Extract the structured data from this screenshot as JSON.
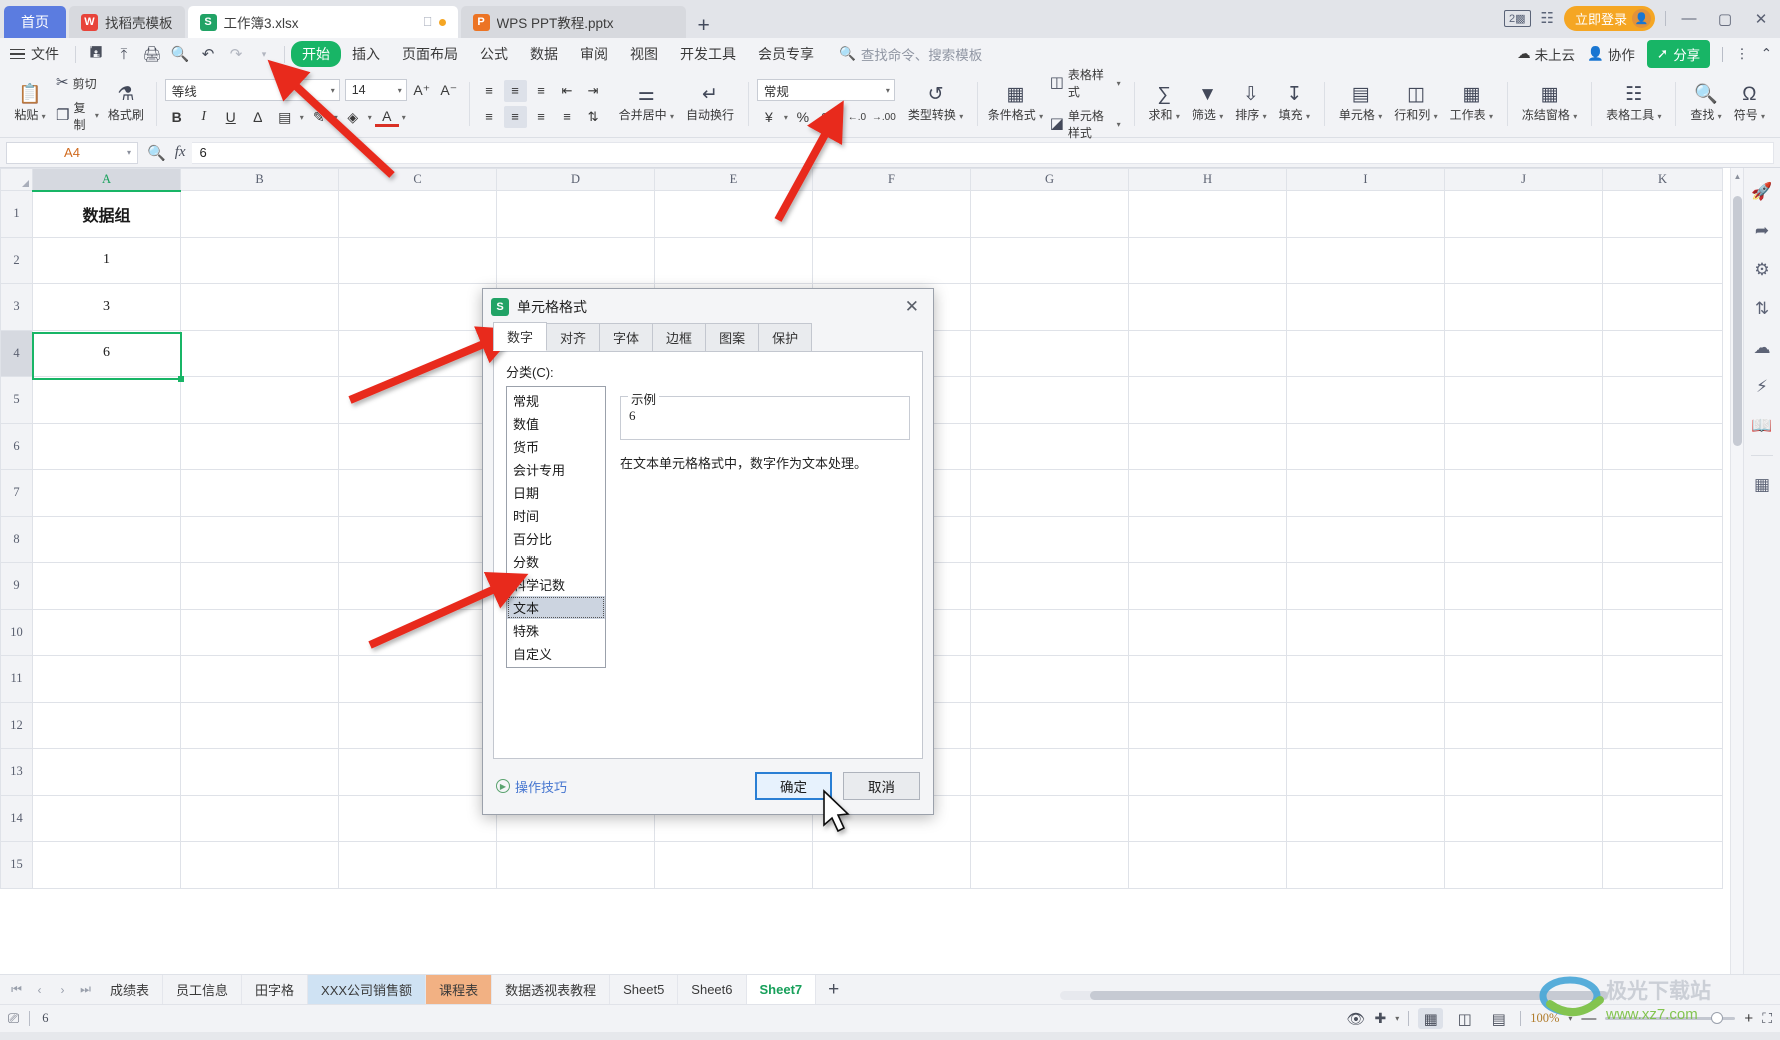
{
  "window": {
    "doc_count_badge": "2",
    "login_label": "立即登录",
    "minimize": "—",
    "maximize": "▢",
    "close": "✕"
  },
  "tabs": [
    {
      "label": "首页",
      "icon": "home-icon",
      "type": "home"
    },
    {
      "label": "找稻壳模板",
      "icon": "docer-icon",
      "type": "docer"
    },
    {
      "label": "工作簿3.xlsx",
      "icon": "xlsx-icon",
      "type": "xlsx",
      "active": true
    },
    {
      "label": "WPS PPT教程.pptx",
      "icon": "pptx-icon",
      "type": "pptx"
    }
  ],
  "tab_new_label": "+",
  "menu": {
    "file_label": "文件",
    "quick_icons": [
      "save-icon",
      "save-as-icon",
      "print-icon",
      "print-preview-icon",
      "undo-icon",
      "redo-icon",
      "customize-qat-icon"
    ],
    "items": [
      {
        "label": "开始",
        "active": true
      },
      {
        "label": "插入"
      },
      {
        "label": "页面布局"
      },
      {
        "label": "公式"
      },
      {
        "label": "数据"
      },
      {
        "label": "审阅"
      },
      {
        "label": "视图"
      },
      {
        "label": "开发工具"
      },
      {
        "label": "会员专享"
      }
    ],
    "search_placeholder": "查找命令、搜索模板",
    "cloud_status": "未上云",
    "collaborate": "协作",
    "share": "分享"
  },
  "ribbon": {
    "clipboard": {
      "paste": "粘贴",
      "cut": "剪切",
      "copy": "复制",
      "format_painter": "格式刷"
    },
    "font": {
      "family": "等线",
      "size": "14",
      "grow": "A⁺",
      "shrink": "A⁻",
      "bold": "B",
      "italic": "I",
      "underline": "U",
      "strikethrough": "A",
      "borders": "田",
      "effects": "文",
      "fill_color": "A",
      "font_color": "A"
    },
    "align": {
      "merge_center": "合并居中",
      "wrap_text": "自动换行"
    },
    "number": {
      "format": "常规",
      "currency": "¥",
      "percent": "%",
      "comma": "000",
      "dec_decrease": ".0",
      "dec_increase": ".00",
      "type_convert": "类型转换"
    },
    "styles": {
      "conditional_format": "条件格式",
      "table_style": "表格样式",
      "cell_style": "单元格样式"
    },
    "editing": {
      "sum": "求和",
      "filter": "筛选",
      "sort": "排序",
      "fill": "填充"
    },
    "cells": {
      "cell": "单元格",
      "rows_cols": "行和列",
      "worksheet": "工作表",
      "freeze_panes": "冻结窗格",
      "table_tools": "表格工具"
    },
    "find": {
      "find": "查找",
      "symbol": "符号"
    }
  },
  "formula_bar": {
    "name_box": "A4",
    "value": "6",
    "zoom_icon": "search-icon",
    "fx": "fx"
  },
  "sheet": {
    "columns": [
      "A",
      "B",
      "C",
      "D",
      "E",
      "F",
      "G",
      "H",
      "I",
      "J",
      "K"
    ],
    "selected_column": "A",
    "rows": [
      "1",
      "2",
      "3",
      "4",
      "5",
      "6",
      "7",
      "8",
      "9",
      "10",
      "11",
      "12",
      "13",
      "14",
      "15"
    ],
    "selected_row": "4",
    "cells": {
      "A1": "数据组",
      "A2": "1",
      "A3": "3",
      "A4": "6"
    },
    "active_cell": "A4"
  },
  "sheet_tabs": {
    "nav": [
      "⏮",
      "‹",
      "›",
      "⏭"
    ],
    "items": [
      {
        "label": "成绩表"
      },
      {
        "label": "员工信息"
      },
      {
        "label": "田字格"
      },
      {
        "label": "XXX公司销售额",
        "color": "blue"
      },
      {
        "label": "课程表",
        "color": "orange"
      },
      {
        "label": "数据透视表教程"
      },
      {
        "label": "Sheet5"
      },
      {
        "label": "Sheet6"
      },
      {
        "label": "Sheet7",
        "active": true
      }
    ],
    "add_label": "+"
  },
  "status_bar": {
    "left_value": "6",
    "zoom": "100%",
    "zoom_out": "—",
    "zoom_in": "+",
    "view_modes": [
      "normal-view-icon",
      "page-layout-icon",
      "page-break-icon"
    ]
  },
  "dialog": {
    "title": "单元格格式",
    "close": "✕",
    "tabs": [
      {
        "label": "数字",
        "active": true
      },
      {
        "label": "对齐"
      },
      {
        "label": "字体"
      },
      {
        "label": "边框"
      },
      {
        "label": "图案"
      },
      {
        "label": "保护"
      }
    ],
    "category_label": "分类(C):",
    "categories": [
      {
        "label": "常规"
      },
      {
        "label": "数值"
      },
      {
        "label": "货币"
      },
      {
        "label": "会计专用"
      },
      {
        "label": "日期"
      },
      {
        "label": "时间"
      },
      {
        "label": "百分比"
      },
      {
        "label": "分数"
      },
      {
        "label": "科学记数"
      },
      {
        "label": "文本",
        "selected": true
      },
      {
        "label": "特殊"
      },
      {
        "label": "自定义"
      }
    ],
    "sample_legend": "示例",
    "sample_value": "6",
    "description": "在文本单元格格式中，数字作为文本处理。",
    "tips_label": "操作技巧",
    "ok_label": "确定",
    "cancel_label": "取消"
  },
  "watermark": {
    "title": "极光下载站",
    "url": "www.xz7.com"
  },
  "colors": {
    "accent_green": "#18b566",
    "home_blue": "#5b7ce0",
    "login_orange": "#f5a623",
    "arrow_red": "#e8291f"
  }
}
